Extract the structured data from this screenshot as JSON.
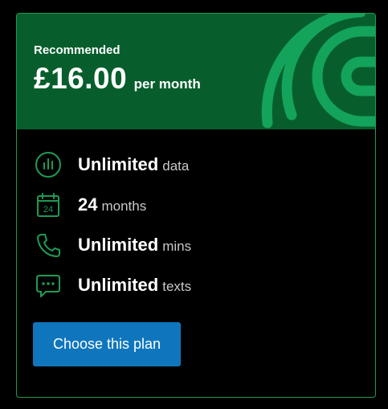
{
  "plan": {
    "badge": "Recommended",
    "price": "£16.00",
    "period": "per month",
    "features": [
      {
        "icon": "data-bars-icon",
        "value": "Unlimited",
        "unit": "data"
      },
      {
        "icon": "calendar-icon",
        "value": "24",
        "unit": "months",
        "icon_text": "24"
      },
      {
        "icon": "phone-icon",
        "value": "Unlimited",
        "unit": "mins"
      },
      {
        "icon": "chat-bubble-icon",
        "value": "Unlimited",
        "unit": "texts"
      }
    ],
    "cta_label": "Choose this plan"
  },
  "colors": {
    "header_bg": "#075e2c",
    "accent_green": "#1f9a55",
    "decor_green": "#14a35a",
    "button_bg": "#0f76bd"
  }
}
